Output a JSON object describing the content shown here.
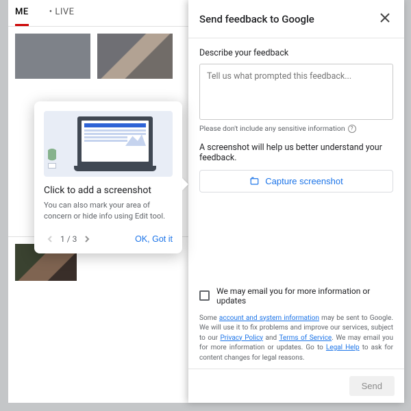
{
  "tabs": {
    "home": "ME",
    "live": "LIVE",
    "live_prefix": "•"
  },
  "panel": {
    "title": "Send feedback to Google",
    "describe_label": "Describe your feedback",
    "textarea_placeholder": "Tell us what prompted this feedback...",
    "sensitive_hint": "Please don't include any sensitive information",
    "screenshot_para": "A screenshot will help us better understand your feedback.",
    "capture_label": "Capture screenshot",
    "email_label": "We may email you for more information or updates",
    "legal_pre": "Some ",
    "legal_link1": "account and system information",
    "legal_mid1": " may be sent to Google. We will use it to fix problems and improve our services, subject to our ",
    "legal_link2": "Privacy Policy",
    "legal_and": " and ",
    "legal_link3": "Terms of Service",
    "legal_mid2": ". We may email you for more information or updates. Go to ",
    "legal_link4": "Legal Help",
    "legal_end": " to ask for content changes for legal reasons.",
    "send_label": "Send"
  },
  "coach": {
    "title": "Click to add a screenshot",
    "body": "You can also mark your area of concern or hide info using Edit tool.",
    "step": "1 / 3",
    "ok": "OK, Got it"
  }
}
